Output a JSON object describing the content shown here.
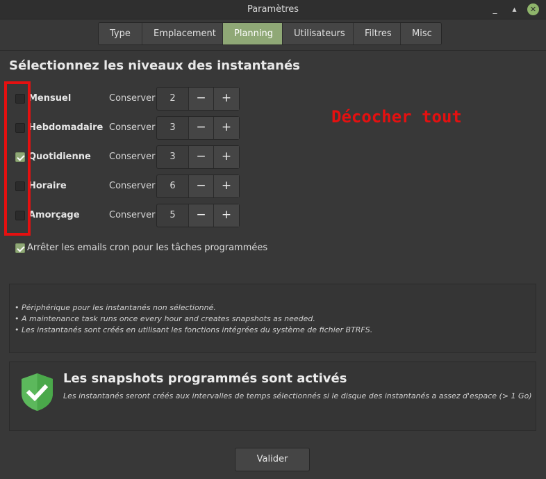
{
  "window": {
    "title": "Paramètres",
    "minimize_icon": "_",
    "maximize_icon": "▴",
    "close_icon": "✕"
  },
  "tabs": [
    {
      "label": "Type",
      "active": false
    },
    {
      "label": "Emplacement",
      "active": false
    },
    {
      "label": "Planning",
      "active": true
    },
    {
      "label": "Utilisateurs",
      "active": false
    },
    {
      "label": "Filtres",
      "active": false
    },
    {
      "label": "Misc",
      "active": false
    }
  ],
  "section": {
    "heading": "Sélectionnez les niveaux des instantanés"
  },
  "levels": [
    {
      "label": "Mensuel",
      "checked": false,
      "keep_label": "Conserver",
      "value": "2"
    },
    {
      "label": "Hebdomadaire",
      "checked": false,
      "keep_label": "Conserver",
      "value": "3"
    },
    {
      "label": "Quotidienne",
      "checked": true,
      "keep_label": "Conserver",
      "value": "3"
    },
    {
      "label": "Horaire",
      "checked": false,
      "keep_label": "Conserver",
      "value": "6"
    },
    {
      "label": "Amorçage",
      "checked": false,
      "keep_label": "Conserver",
      "value": "5"
    }
  ],
  "spin_buttons": {
    "minus": "−",
    "plus": "+"
  },
  "annotation": {
    "text": "Décocher tout",
    "color": "#e51010"
  },
  "cron": {
    "label": "Arrêter les emails cron pour les tâches programmées",
    "checked": true
  },
  "info": {
    "lines": [
      "• Périphérique pour les instantanés non sélectionné.",
      "• A maintenance task runs once every hour and creates snapshots as needed.",
      "• Les instantanés sont créés en utilisant les fonctions intégrées du système de fichier BTRFS."
    ]
  },
  "status": {
    "icon": "shield-check-icon",
    "title": "Les snapshots programmés sont activés",
    "subtitle": "Les instantanés seront créés aux intervalles de temps sélectionnés si le disque des instantanés a assez d'espace (> 1 Go)",
    "accent": "#5cb85c"
  },
  "footer": {
    "validate_label": "Valider"
  }
}
